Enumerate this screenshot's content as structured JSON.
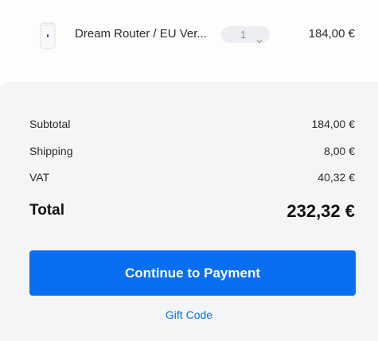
{
  "cart_item": {
    "name": "Dream Router / EU Ver...",
    "quantity": "1",
    "price": "184,00 €",
    "thumbnail_icon": "router-device-icon",
    "quantity_icon": "chevron-down-icon"
  },
  "summary": {
    "subtotal_label": "Subtotal",
    "subtotal_value": "184,00 €",
    "shipping_label": "Shipping",
    "shipping_value": "8,00 €",
    "vat_label": "VAT",
    "vat_value": "40,32 €",
    "total_label": "Total",
    "total_value": "232,32 €"
  },
  "actions": {
    "continue_label": "Continue to Payment",
    "gift_code_label": "Gift Code"
  },
  "colors": {
    "accent": "#0a6ef2",
    "panel_background": "#f4f5f6",
    "page_background": "#fdfdfb"
  }
}
